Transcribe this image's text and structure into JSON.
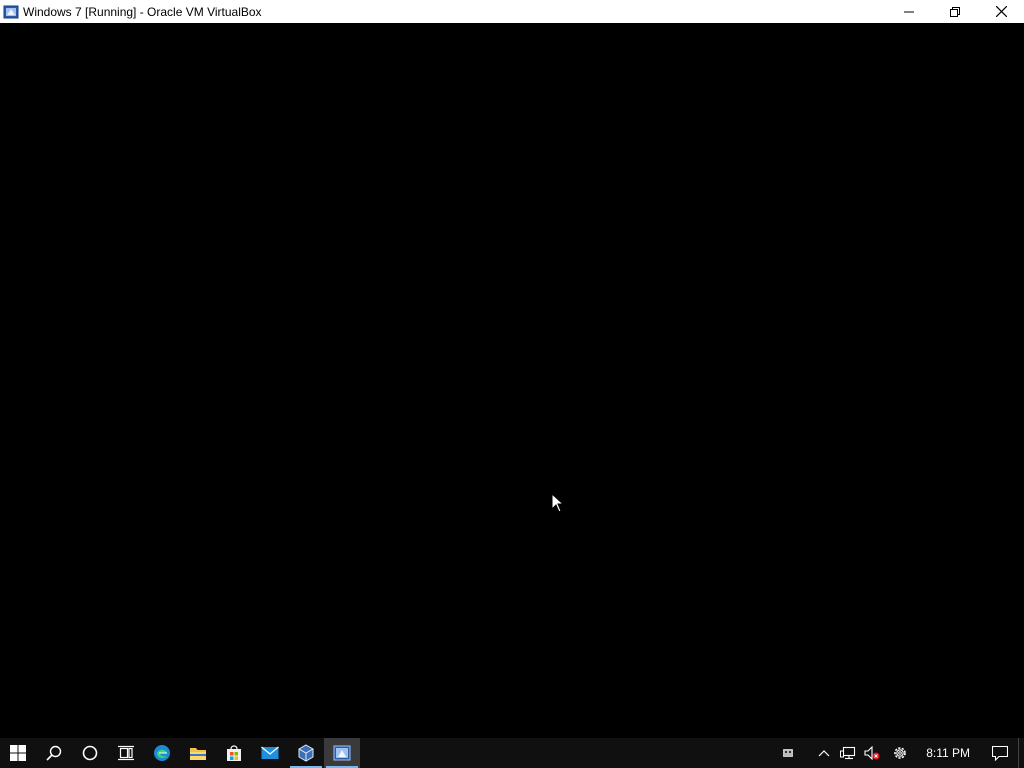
{
  "window": {
    "title": "Windows 7 [Running] - Oracle VM VirtualBox",
    "icon": "virtualbox-app-icon",
    "controls": [
      "minimize-icon",
      "restore-icon",
      "close-icon"
    ]
  },
  "vm_display": {
    "content": "",
    "background": "#000000"
  },
  "taskbar": {
    "background": "#101010",
    "accent": "#76b9ed",
    "buttons": [
      {
        "name": "start",
        "icon": "windows-logo-icon"
      },
      {
        "name": "search",
        "icon": "search-icon"
      },
      {
        "name": "cortana",
        "icon": "cortana-circle-icon"
      },
      {
        "name": "task-view",
        "icon": "task-view-icon"
      },
      {
        "name": "edge",
        "icon": "edge-icon"
      },
      {
        "name": "file-explorer",
        "icon": "folder-icon"
      },
      {
        "name": "store",
        "icon": "store-bag-icon"
      },
      {
        "name": "mail",
        "icon": "mail-icon"
      },
      {
        "name": "virtualbox-manager",
        "icon": "virtualbox-cube-icon"
      },
      {
        "name": "virtualbox-vm",
        "icon": "virtualbox-app-icon"
      }
    ],
    "tray": {
      "icons": [
        "input-indicator-icon",
        "chevron-up-icon",
        "network-icon",
        "volume-muted-icon",
        "settings-gear-icon"
      ],
      "clock": "8:11 PM",
      "notification_icon": "action-center-icon"
    }
  }
}
